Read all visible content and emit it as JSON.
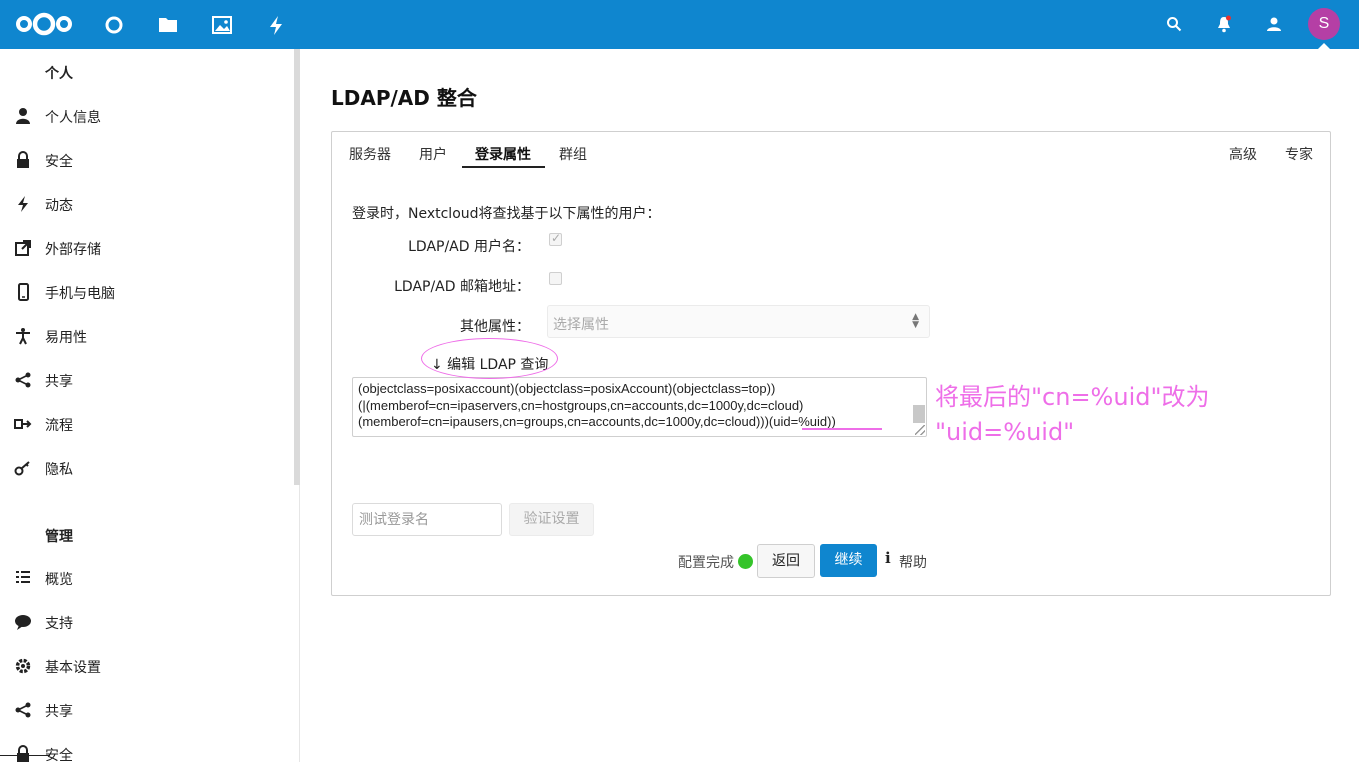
{
  "nav": {
    "apps": [
      "dashboard-icon",
      "files-icon",
      "photos-icon",
      "activity-icon"
    ],
    "right": [
      "search-icon",
      "notifications-icon",
      "contacts-icon"
    ],
    "avatar_letter": "S",
    "accent_color": "#0f86cf",
    "avatar_color": "#b53fa5"
  },
  "sidebar": {
    "personal_title": "个人",
    "personal_items": [
      {
        "label": "个人信息",
        "icon": "user-icon"
      },
      {
        "label": "安全",
        "icon": "lock-icon"
      },
      {
        "label": "动态",
        "icon": "activity-icon"
      },
      {
        "label": "外部存储",
        "icon": "external-link-icon"
      },
      {
        "label": "手机与电脑",
        "icon": "phone-icon"
      },
      {
        "label": "易用性",
        "icon": "accessibility-icon"
      },
      {
        "label": "共享",
        "icon": "share-icon"
      },
      {
        "label": "流程",
        "icon": "flow-icon"
      },
      {
        "label": "隐私",
        "icon": "key-icon"
      }
    ],
    "admin_title": "管理",
    "admin_items": [
      {
        "label": "概览",
        "icon": "list-icon"
      },
      {
        "label": "支持",
        "icon": "chat-icon"
      },
      {
        "label": "基本设置",
        "icon": "gear-icon"
      },
      {
        "label": "共享",
        "icon": "share-icon"
      },
      {
        "label": "安全",
        "icon": "lock-icon"
      }
    ]
  },
  "main": {
    "title": "LDAP/AD 整合",
    "tabs_left": [
      "服务器",
      "用户",
      "登录属性",
      "群组"
    ],
    "active_tab": "登录属性",
    "tabs_right": [
      "高级",
      "专家"
    ],
    "intro": "登录时，Nextcloud将查找基于以下属性的用户：",
    "username_label": "LDAP/AD 用户名：",
    "username_checked": true,
    "email_label": "LDAP/AD 邮箱地址：",
    "email_checked": false,
    "other_label": "其他属性：",
    "select_placeholder": "选择属性",
    "edit_link": "↓ 编辑 LDAP 查询",
    "query_lines": [
      "(objectclass=posixaccount)(objectclass=posixAccount)(objectclass=top))",
      "(|(memberof=cn=ipaservers,cn=hostgroups,cn=accounts,dc=1000y,dc=cloud)",
      "(memberof=cn=ipausers,cn=groups,cn=accounts,dc=1000y,dc=cloud)))(uid=%uid))"
    ],
    "test_placeholder": "测试登录名",
    "verify_button": "验证设置",
    "status_text": "配置完成",
    "status_color": "#35c42a",
    "back_button": "返回",
    "continue_button": "继续",
    "help_label": "帮助"
  },
  "annotation": {
    "line1": "将最后的\"cn=%uid\"改为",
    "line2": "\"uid=%uid\"",
    "color": "#ee6ee8"
  }
}
